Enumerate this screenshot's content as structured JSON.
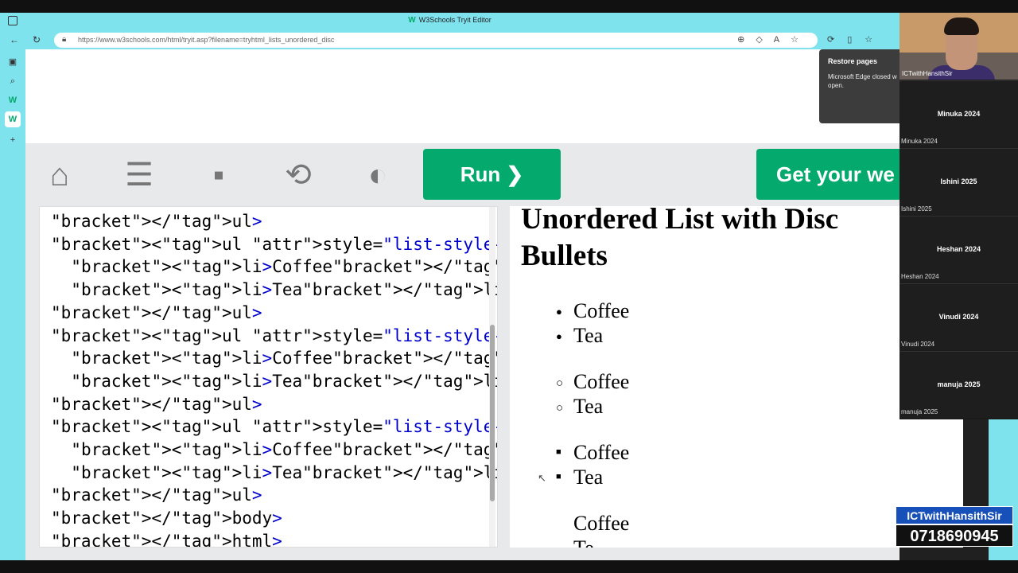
{
  "browser": {
    "window_title": "W3Schools Tryit Editor",
    "url": "https://www.w3schools.com/html/tryit.asp?filename=tryhtml_lists_unordered_disc"
  },
  "toolbar": {
    "run_label": "Run  ❯",
    "get_label": "Get your we"
  },
  "code_lines": [
    "</ul>",
    "<ul style=\"list-style-type:circle;\">",
    "  <li>Coffee</li>",
    "  <li>Tea</li>",
    "</ul>",
    "<ul style=\"list-style-type:square;\">",
    "  <li>Coffee</li>",
    "  <li>Tea</li>",
    "</ul>",
    "<ul style=\"list-style-type:none;\">",
    "  <li>Coffee</li>",
    "  <li>Tea</li>",
    "</ul>",
    "</body>",
    "</html>"
  ],
  "result": {
    "heading": "Unordered List with Disc Bullets",
    "lists": [
      {
        "style": "disc",
        "items": [
          "Coffee",
          "Tea"
        ]
      },
      {
        "style": "circle",
        "items": [
          "Coffee",
          "Tea"
        ]
      },
      {
        "style": "square",
        "items": [
          "Coffee",
          "Tea"
        ]
      },
      {
        "style": "none",
        "items": [
          "Coffee",
          "Te"
        ]
      }
    ]
  },
  "notification": {
    "title": "Restore pages",
    "body": "Microsoft Edge closed w open."
  },
  "participants": {
    "presenter": "ICTwithHansithSir",
    "tiles": [
      {
        "center": "Minuka 2024",
        "label": "Minuka 2024"
      },
      {
        "center": "Ishini 2025",
        "label": "Ishini 2025"
      },
      {
        "center": "Heshan 2024",
        "label": "Heshan 2024"
      },
      {
        "center": "Vinudi 2024",
        "label": "Vinudi 2024"
      },
      {
        "center": "manuja 2025",
        "label": "manuja 2025"
      }
    ]
  },
  "overlay": {
    "channel": "ICTwithHansithSir",
    "phone": "0718690945"
  },
  "colors": {
    "accent_green": "#04aa6d",
    "chrome_cyan": "#7fe3ee"
  }
}
